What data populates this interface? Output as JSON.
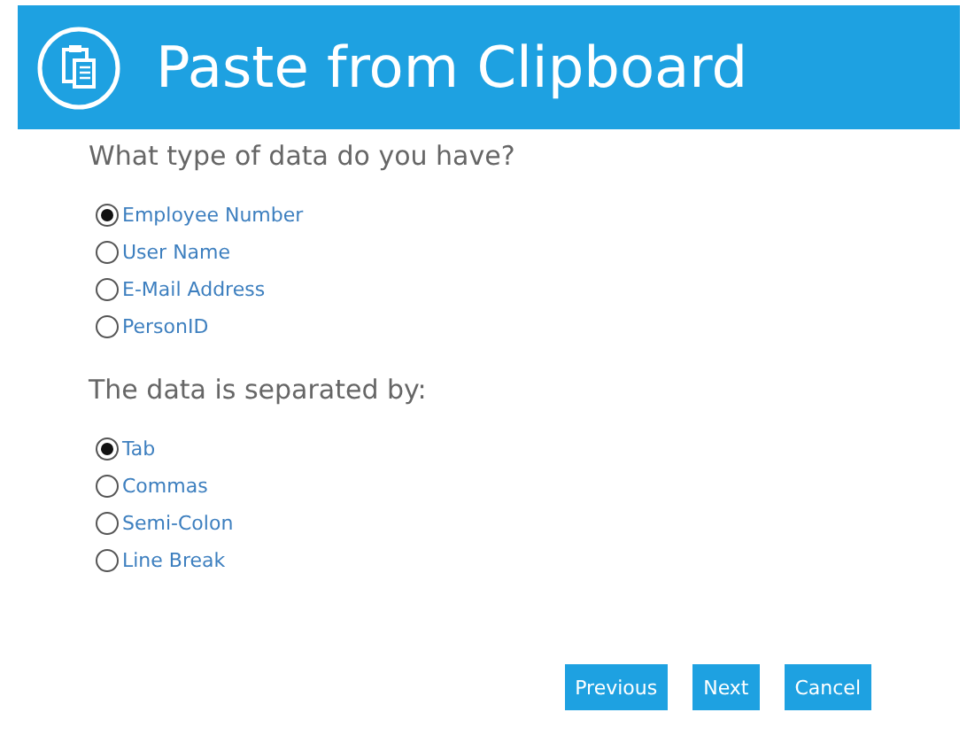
{
  "header": {
    "title": "Paste from Clipboard"
  },
  "groups": [
    {
      "question": "What type of data do you have?",
      "options": [
        {
          "label": "Employee Number",
          "selected": true
        },
        {
          "label": "User Name",
          "selected": false
        },
        {
          "label": "E-Mail Address",
          "selected": false
        },
        {
          "label": "PersonID",
          "selected": false
        }
      ]
    },
    {
      "question": "The data is separated by:",
      "options": [
        {
          "label": "Tab",
          "selected": true
        },
        {
          "label": "Commas",
          "selected": false
        },
        {
          "label": "Semi-Colon",
          "selected": false
        },
        {
          "label": "Line Break",
          "selected": false
        }
      ]
    }
  ],
  "buttons": [
    "Previous",
    "Next",
    "Cancel"
  ]
}
